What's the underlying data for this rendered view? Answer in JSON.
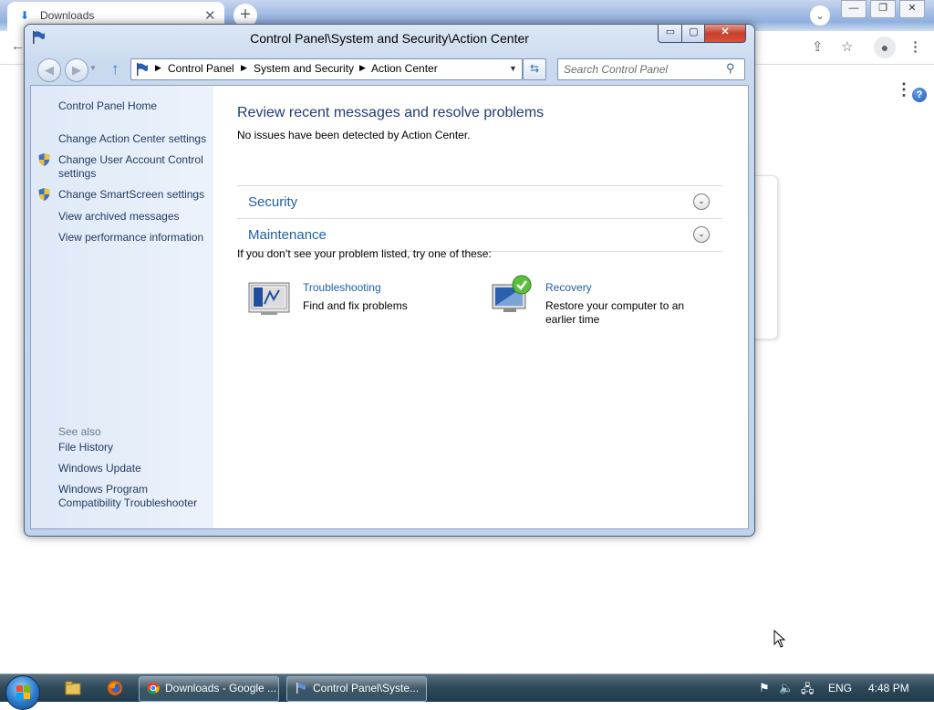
{
  "browser": {
    "tab_title": "Downloads",
    "tab_close": "✕",
    "new_tab": "+",
    "win_min": "—",
    "win_max": "❐",
    "win_close": "✕"
  },
  "window": {
    "title": "Control Panel\\System and Security\\Action Center",
    "min": "▭",
    "max": "▢",
    "close": "✕"
  },
  "address": {
    "crumbs": [
      "Control Panel",
      "System and Security",
      "Action Center"
    ],
    "search_placeholder": "Search Control Panel"
  },
  "sidebar": {
    "home": "Control Panel Home",
    "links": [
      "Change Action Center settings",
      "Change User Account Control settings",
      "Change SmartScreen settings",
      "View archived messages",
      "View performance information"
    ],
    "see_also_heading": "See also",
    "see_also": [
      "File History",
      "Windows Update",
      "Windows Program Compatibility Troubleshooter"
    ]
  },
  "main": {
    "title": "Review recent messages and resolve problems",
    "subtitle": "No issues have been detected by Action Center.",
    "sections": [
      "Security",
      "Maintenance"
    ],
    "hint": "If you don’t see your problem listed, try one of these:",
    "tools": [
      {
        "title": "Troubleshooting",
        "description": "Find and fix problems"
      },
      {
        "title": "Recovery",
        "description": "Restore your computer to an earlier time"
      }
    ],
    "help": "?"
  },
  "taskbar": {
    "buttons": [
      "Downloads - Google ...",
      "Control Panel\\Syste..."
    ],
    "language": "ENG",
    "clock": "4:48 PM"
  },
  "colors": {
    "link": "#1e5fa8",
    "title_blue": "#1e3d73",
    "sidebar_link": "#1e3a5f",
    "close_red": "#c7402a"
  }
}
